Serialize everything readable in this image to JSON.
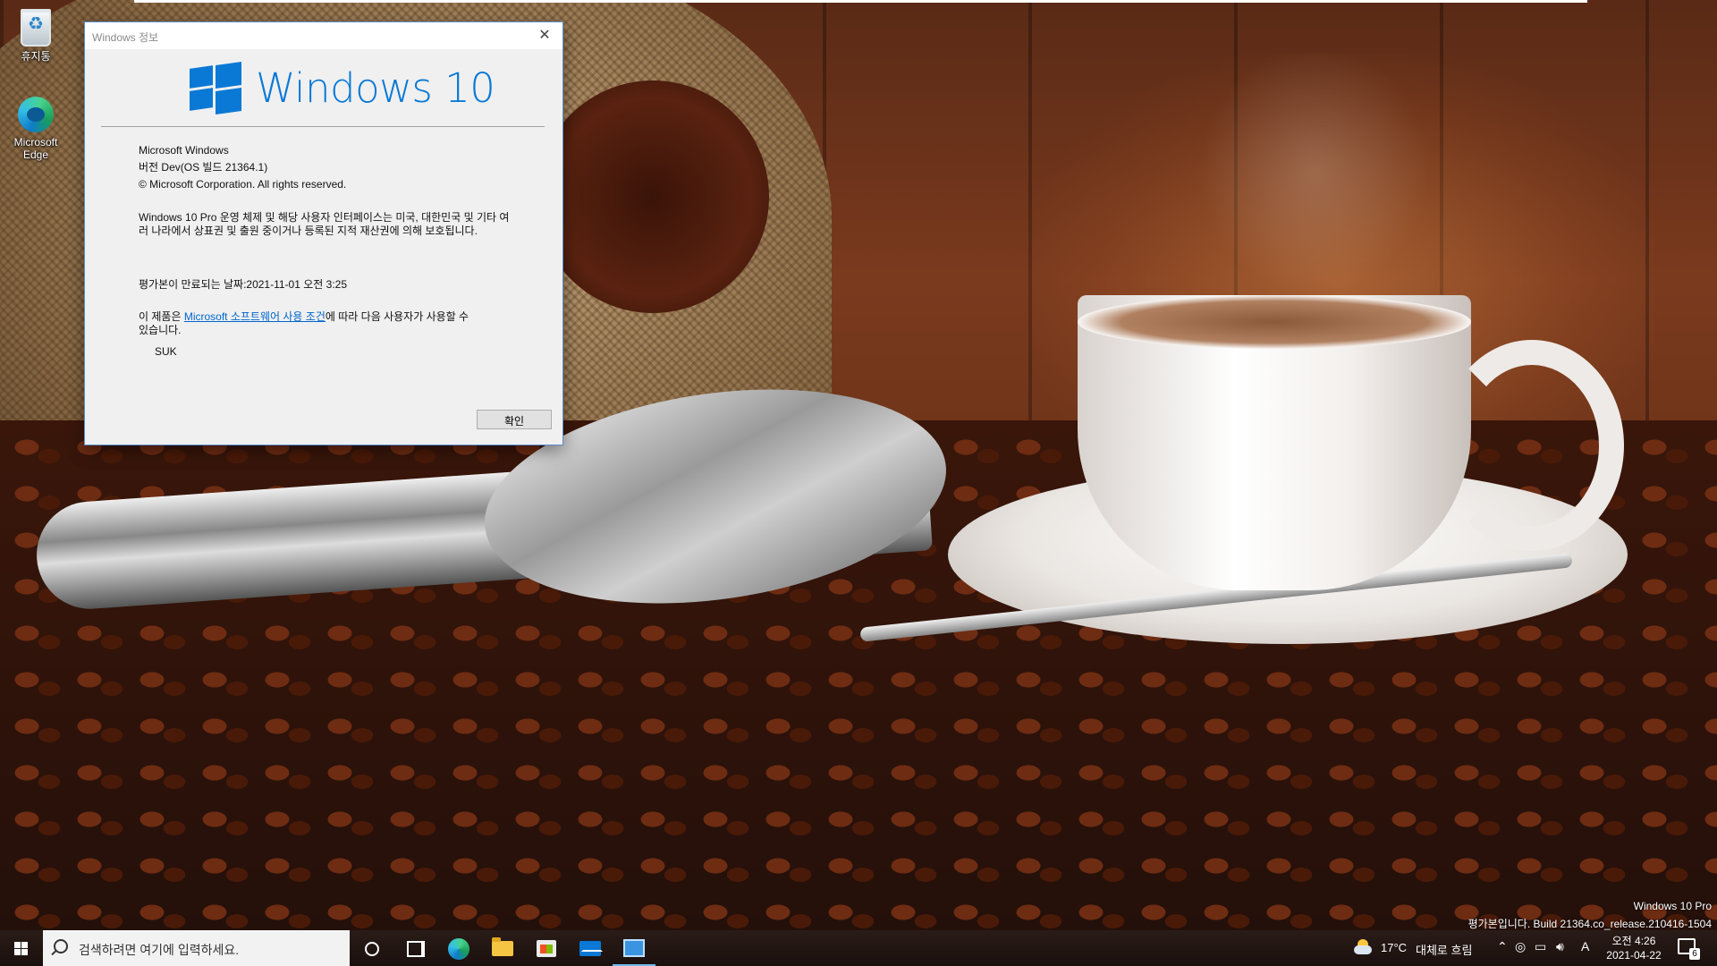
{
  "desktop": {
    "icons": [
      {
        "label": "휴지통"
      },
      {
        "label": "Microsoft Edge"
      }
    ]
  },
  "dialog": {
    "title": "Windows 정보",
    "close_glyph": "✕",
    "logo_text": "Windows 10",
    "product": "Microsoft Windows",
    "version": "버전 Dev(OS 빌드 21364.1)",
    "copyright": "© Microsoft Corporation. All rights reserved.",
    "description": "Windows 10 Pro 운영 체제 및 해당 사용자 인터페이스는 미국, 대한민국 및 기타 여러 나라에서 상표권 및 출원 중이거나 등록된 지적 재산권에 의해 보호됩니다.",
    "expiry": "평가본이 만료되는 날짜:2021-11-01 오전 3:25",
    "license_prefix": "이 제품은 ",
    "license_link": "Microsoft 소프트웨어 사용 조건",
    "license_suffix": "에 따라 다음 사용자가 사용할 수 있습니다.",
    "user": "SUK",
    "ok_label": "확인"
  },
  "watermark": {
    "line1": "Windows 10 Pro",
    "line2": "평가본입니다. Build 21364.co_release.210416-1504"
  },
  "taskbar": {
    "search_placeholder": "검색하려면 여기에 입력하세요.",
    "apps": [
      "cortana",
      "task-view",
      "edge",
      "file-explorer",
      "microsoft-store",
      "mail",
      "active-app"
    ],
    "weather_temp": "17°C",
    "weather_desc": "대체로 흐림",
    "ime_label": "A",
    "clock_time": "오전 4:26",
    "clock_date": "2021-04-22",
    "notification_count": "6"
  },
  "colors": {
    "accent": "#0a79d6",
    "link": "#0066cc",
    "taskbar": "#1a100d"
  }
}
